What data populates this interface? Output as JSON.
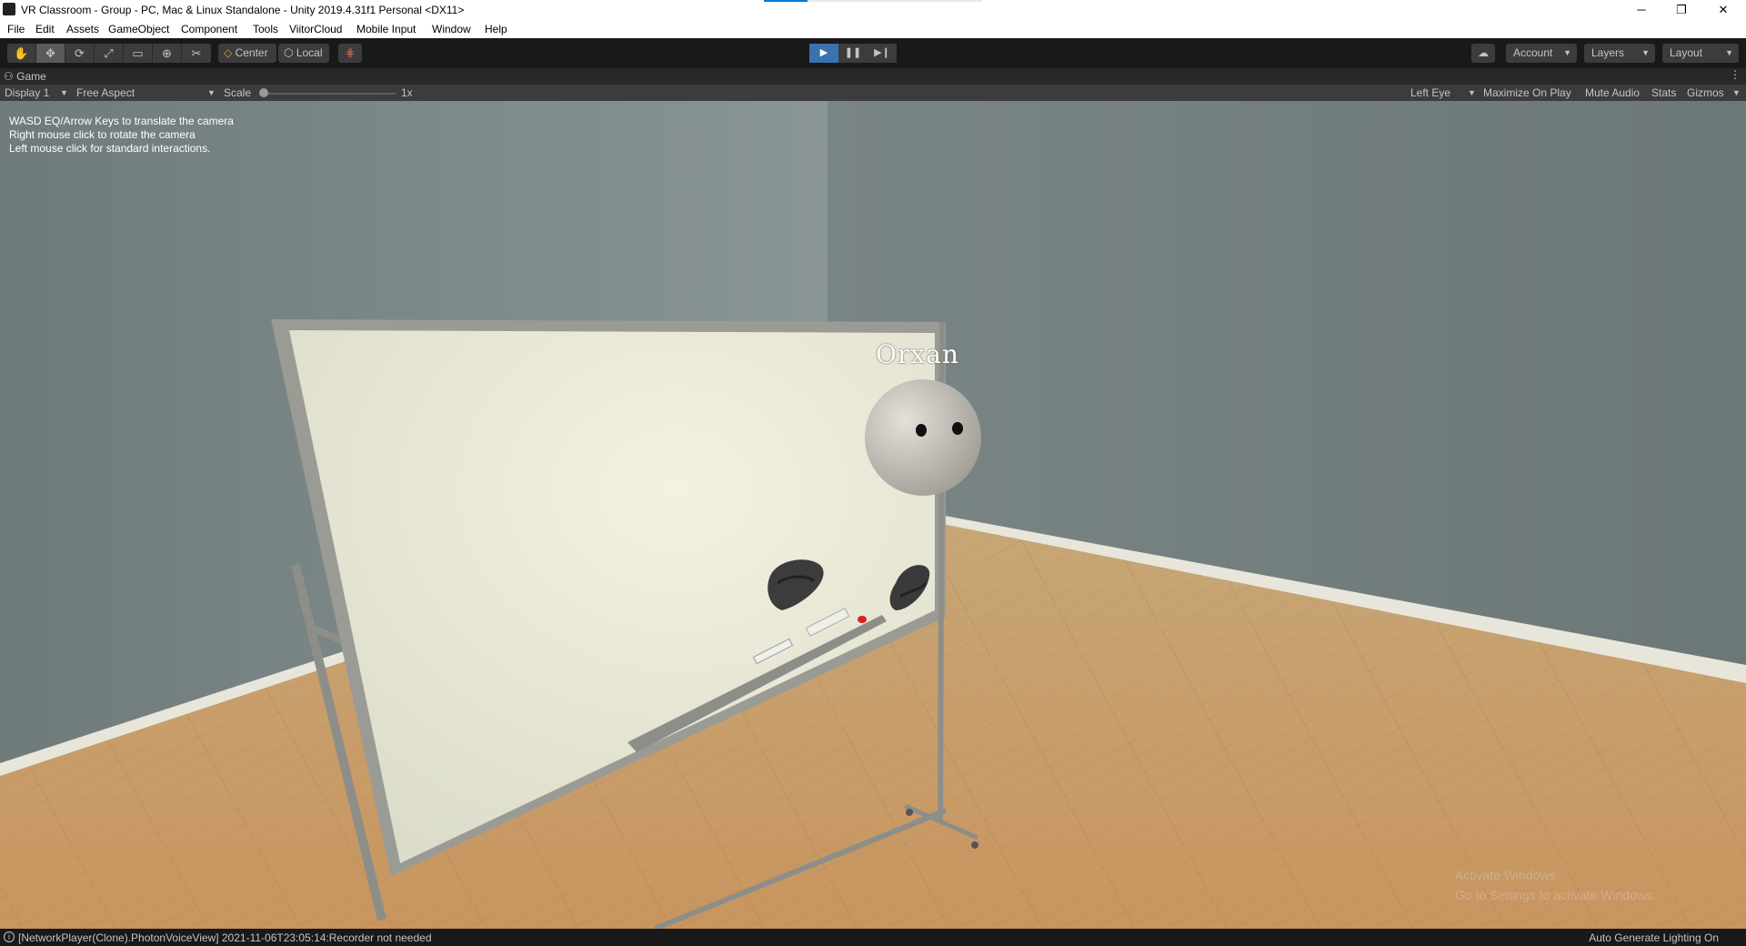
{
  "window": {
    "title": "VR Classroom - Group - PC, Mac & Linux Standalone - Unity 2019.4.31f1 Personal <DX11>",
    "minimize": "─",
    "restore": "❐",
    "close": "✕"
  },
  "menu": [
    "File",
    "Edit",
    "Assets",
    "GameObject",
    "Component",
    "Tools",
    "ViitorCloud",
    "Mobile Input",
    "Window",
    "Help"
  ],
  "toolbar": {
    "pivot_label": "Center",
    "space_label": "Local",
    "account_label": "Account",
    "layers_label": "Layers",
    "layout_label": "Layout"
  },
  "game_tab": {
    "label": "Game"
  },
  "game_bar": {
    "display": "Display 1",
    "aspect": "Free Aspect",
    "scale_label": "Scale",
    "scale_value": "1x",
    "eye": "Left Eye",
    "maximize": "Maximize On Play",
    "mute": "Mute Audio",
    "stats": "Stats",
    "gizmos": "Gizmos"
  },
  "game_view": {
    "hints": [
      "WASD EQ/Arrow Keys to translate the camera",
      "Right mouse click to rotate the camera",
      "Left mouse click for standard interactions."
    ],
    "player_name": "Orxan",
    "watermark": [
      "Activate Windows",
      "Go to Settings to activate Windows."
    ]
  },
  "status": {
    "message": "[NetworkPlayer(Clone).PhotonVoiceView] 2021-11-06T23:05:14:Recorder not needed",
    "right": "Auto Generate Lighting On"
  },
  "colors": {
    "toolbar_bg": "#191919",
    "button_bg": "#3c3c3c",
    "play_active": "#3a72b0",
    "wall": "#7a8686",
    "floor": "#c49b6a"
  }
}
